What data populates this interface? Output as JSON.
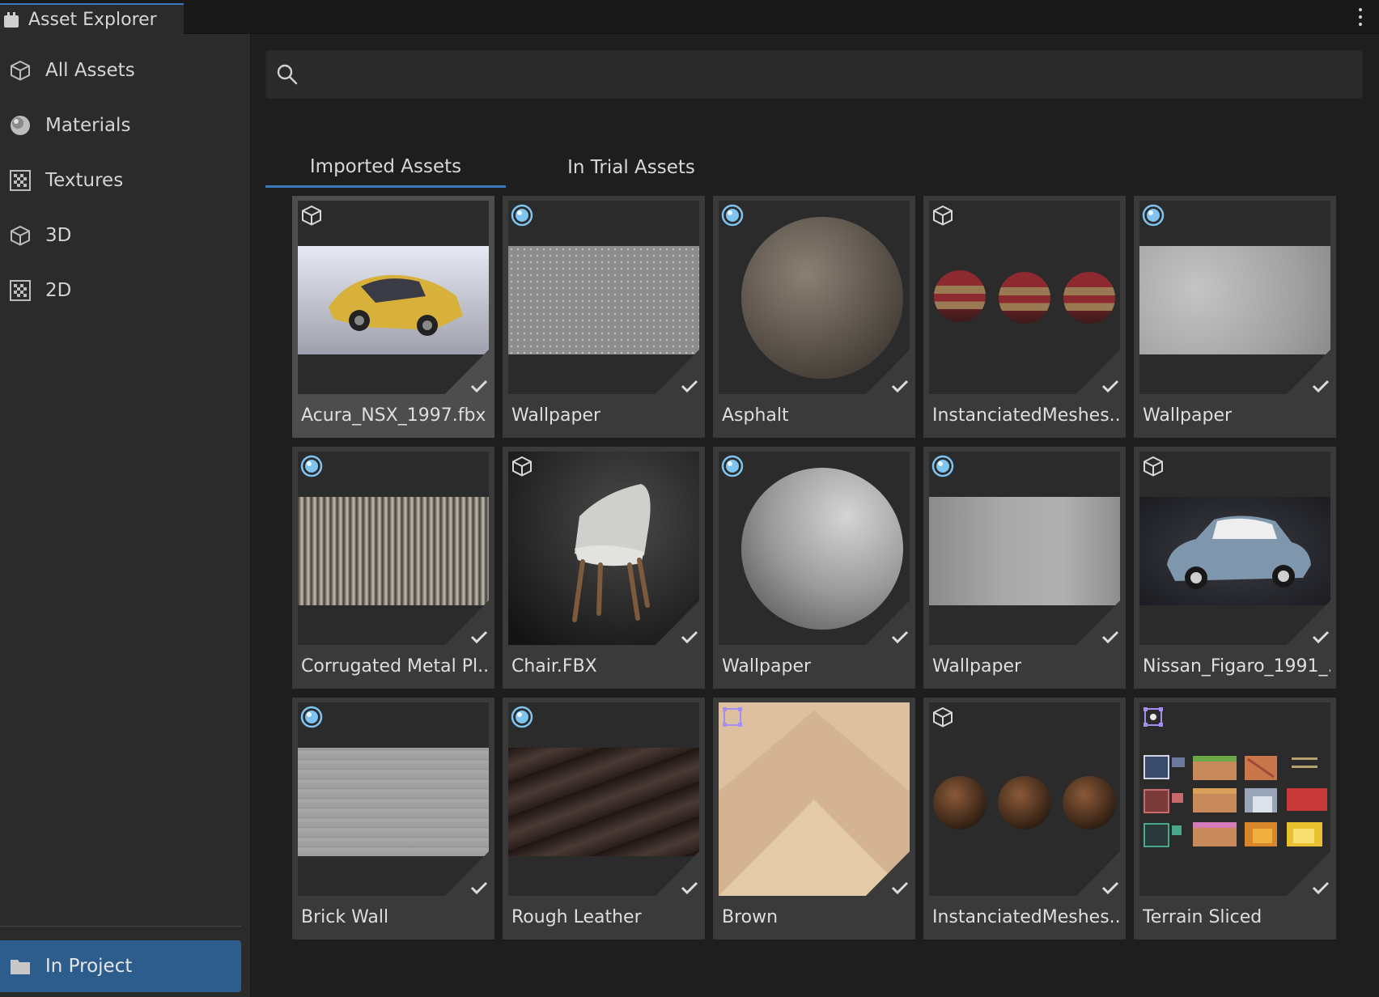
{
  "window": {
    "tab_title": "Asset Explorer"
  },
  "sidebar": {
    "items": [
      {
        "label": "All Assets",
        "icon": "cube-icon"
      },
      {
        "label": "Materials",
        "icon": "material-sphere-icon"
      },
      {
        "label": "Textures",
        "icon": "checker-texture-icon"
      },
      {
        "label": "3D",
        "icon": "cube-icon"
      },
      {
        "label": "2D",
        "icon": "checker-texture-icon"
      }
    ],
    "footer": {
      "label": "In Project",
      "icon": "folder-icon"
    }
  },
  "search": {
    "value": "",
    "placeholder": ""
  },
  "tabs": [
    {
      "label": "Imported Assets",
      "active": true
    },
    {
      "label": "In Trial Assets",
      "active": false
    }
  ],
  "assets": [
    {
      "title": "Acura_NSX_1997.fbx",
      "type": "model",
      "selected": true,
      "imported": true
    },
    {
      "title": "Wallpaper",
      "type": "material",
      "imported": true
    },
    {
      "title": "Asphalt",
      "type": "material",
      "imported": true
    },
    {
      "title": "InstanciatedMeshes...",
      "type": "model",
      "imported": true
    },
    {
      "title": "Wallpaper",
      "type": "material",
      "imported": true
    },
    {
      "title": "Corrugated Metal Pl...",
      "type": "material",
      "imported": true
    },
    {
      "title": "Chair.FBX",
      "type": "model",
      "imported": true
    },
    {
      "title": "Wallpaper",
      "type": "material",
      "imported": true
    },
    {
      "title": "Wallpaper",
      "type": "material",
      "imported": true
    },
    {
      "title": "Nissan_Figaro_1991_...",
      "type": "model",
      "imported": true
    },
    {
      "title": "Brick Wall",
      "type": "material",
      "imported": true
    },
    {
      "title": "Rough Leather",
      "type": "material",
      "imported": true
    },
    {
      "title": "Brown",
      "type": "sprite",
      "imported": true
    },
    {
      "title": "InstanciatedMeshes....",
      "type": "model",
      "imported": true
    },
    {
      "title": "Terrain Sliced",
      "type": "sprite",
      "imported": true
    }
  ],
  "colors": {
    "accent": "#3a79bb",
    "selection": "#2d5d8d",
    "material_icon": "#7fc3f0",
    "sprite_icon": "#a58ef0"
  }
}
